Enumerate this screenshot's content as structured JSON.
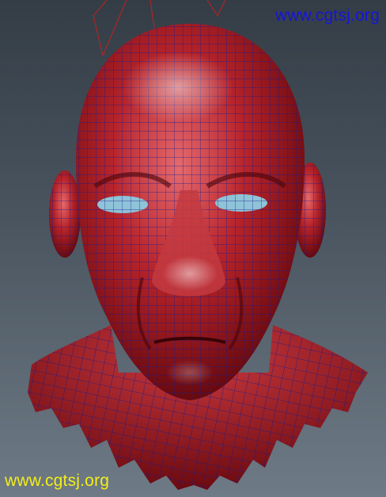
{
  "watermarks": {
    "top_right": "www.cgtsj.org",
    "bottom_left": "www.cgtsj.org"
  },
  "colors": {
    "background_top": "#343d46",
    "background_bottom": "#6e7a85",
    "mesh_fill": "#a3141d",
    "wireframe": "#1a1a8c",
    "rig_lines": "#c02020",
    "watermark_top": "#1515d8",
    "watermark_bottom": "#f3ee1a"
  }
}
